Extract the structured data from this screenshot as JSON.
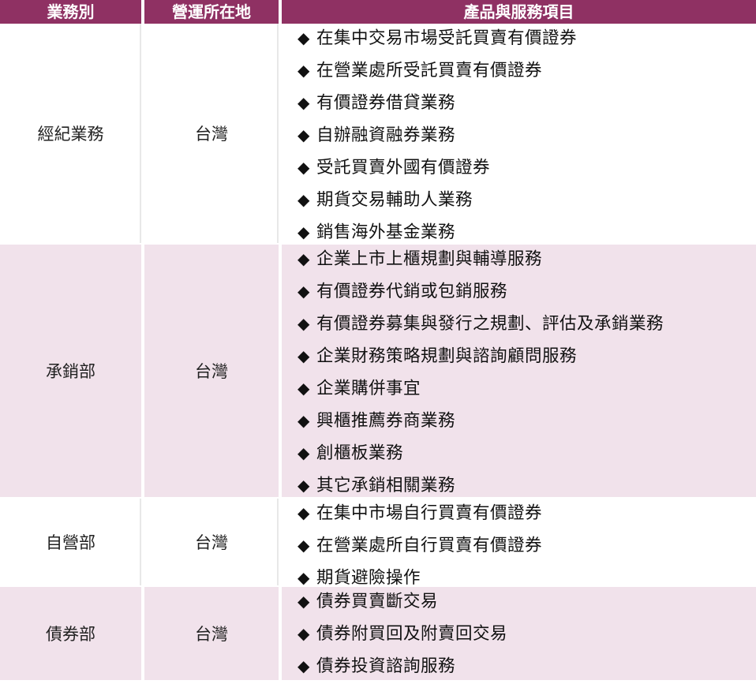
{
  "header": {
    "col1": "業務別",
    "col2": "營運所在地",
    "col3": "產品與服務項目"
  },
  "bullet_glyph": "◆",
  "rows": [
    {
      "business": "經紀業務",
      "location": "台灣",
      "items": [
        "在集中交易市場受託買賣有價證券",
        "在營業處所受託買賣有價證券",
        "有價證券借貸業務",
        "自辦融資融券業務",
        "受託買賣外國有價證券",
        "期貨交易輔助人業務",
        "銷售海外基金業務"
      ]
    },
    {
      "business": "承銷部",
      "location": "台灣",
      "items": [
        "企業上市上櫃規劃與輔導服務",
        "有價證券代銷或包銷服務",
        "有價證券募集與發行之規劃、評估及承銷業務",
        "企業財務策略規劃與諮詢顧問服務",
        "企業購併事宜",
        "興櫃推薦券商業務",
        "創櫃板業務",
        "其它承銷相關業務"
      ]
    },
    {
      "business": "自營部",
      "location": "台灣",
      "items": [
        "在集中市場自行買賣有價證券",
        "在營業處所自行買賣有價證券",
        "期貨避險操作"
      ]
    },
    {
      "business": "債券部",
      "location": "台灣",
      "items": [
        "債券買賣斷交易",
        "債券附買回及附賣回交易",
        "債券投資諮詢服務"
      ]
    }
  ],
  "colors": {
    "header_bg": "#8f3163",
    "header_text": "#ffffff",
    "alt_row_bg": "#f1e2eb"
  }
}
